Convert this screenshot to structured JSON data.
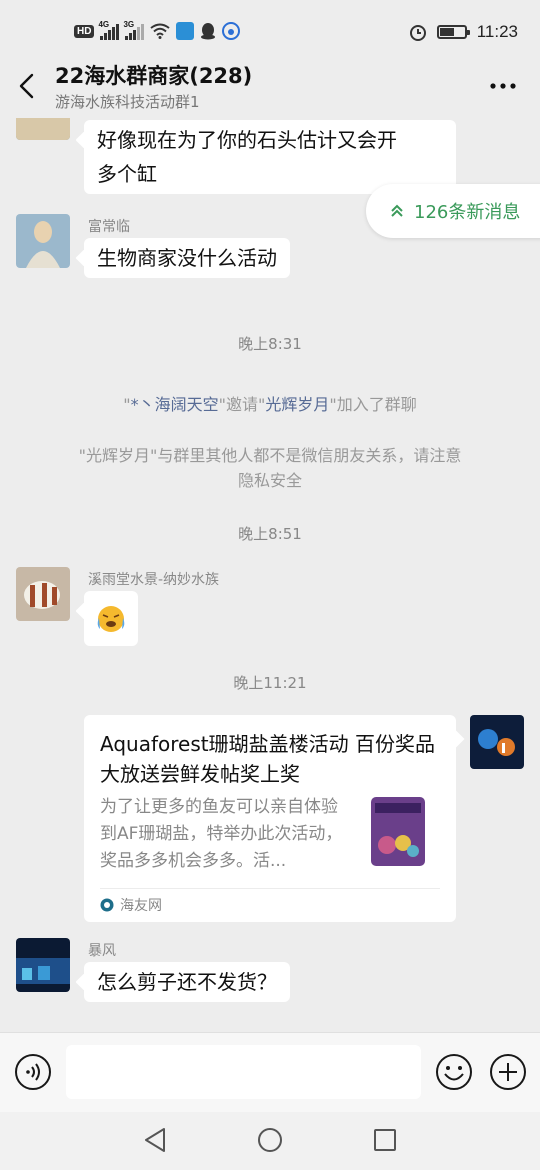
{
  "status_bar": {
    "hd": "HD",
    "net1": "4G",
    "net2": "3G",
    "time": "11:23",
    "battery_level": 0.55,
    "icons": [
      "hd-icon",
      "signal-icon",
      "signal-icon",
      "wifi-icon",
      "app-notification-icon",
      "qq-icon",
      "baidu-icon",
      "alarm-icon",
      "battery-icon"
    ]
  },
  "header": {
    "title": "22海水群商家(228)",
    "subtitle": "游海水族科技活动群1",
    "back_icon": "chevron-left-icon",
    "more_icon": "more-icon"
  },
  "new_messages": {
    "label": "126条新消息",
    "icon": "double-chevron-up-icon",
    "color": "#3a9a5a"
  },
  "messages": [
    {
      "type": "text",
      "sender": "",
      "text_line1": "好像现在为了你的石头估计又会开",
      "text_line2": "多个缸"
    },
    {
      "type": "text",
      "sender": "富常临",
      "text": "生物商家没什么活动"
    },
    {
      "type": "time",
      "text": "晚上8:31"
    },
    {
      "type": "system",
      "q1": "\"",
      "inviter": "*丶海阔天空",
      "q2": "\"邀请\"",
      "invitee": "光辉岁月",
      "q3": "\"加入了群聊"
    },
    {
      "type": "system",
      "line1": "\"光辉岁月\"与群里其他人都不是微信朋友关系，请注意",
      "line2": "隐私安全"
    },
    {
      "type": "time",
      "text": "晚上8:51"
    },
    {
      "type": "text",
      "sender": "溪雨堂水景-纳妙水族",
      "text": "😭"
    },
    {
      "type": "time",
      "text": "晚上11:21"
    },
    {
      "type": "link_card",
      "title": "Aquaforest珊瑚盐盖楼活动 百份奖品大放送尝鲜发帖奖上奖",
      "description": "为了让更多的鱼友可以亲自体验到AF珊瑚盐，特举办此次活动，奖品多多机会多多。活...",
      "source": "海友网"
    },
    {
      "type": "text",
      "sender": "暴风",
      "text": "怎么剪子还不发货？"
    }
  ],
  "input_bar": {
    "placeholder": "",
    "value": ""
  },
  "colors": {
    "background": "#ededed",
    "link_name": "#576b95",
    "accent_green": "#3a9a5a"
  }
}
